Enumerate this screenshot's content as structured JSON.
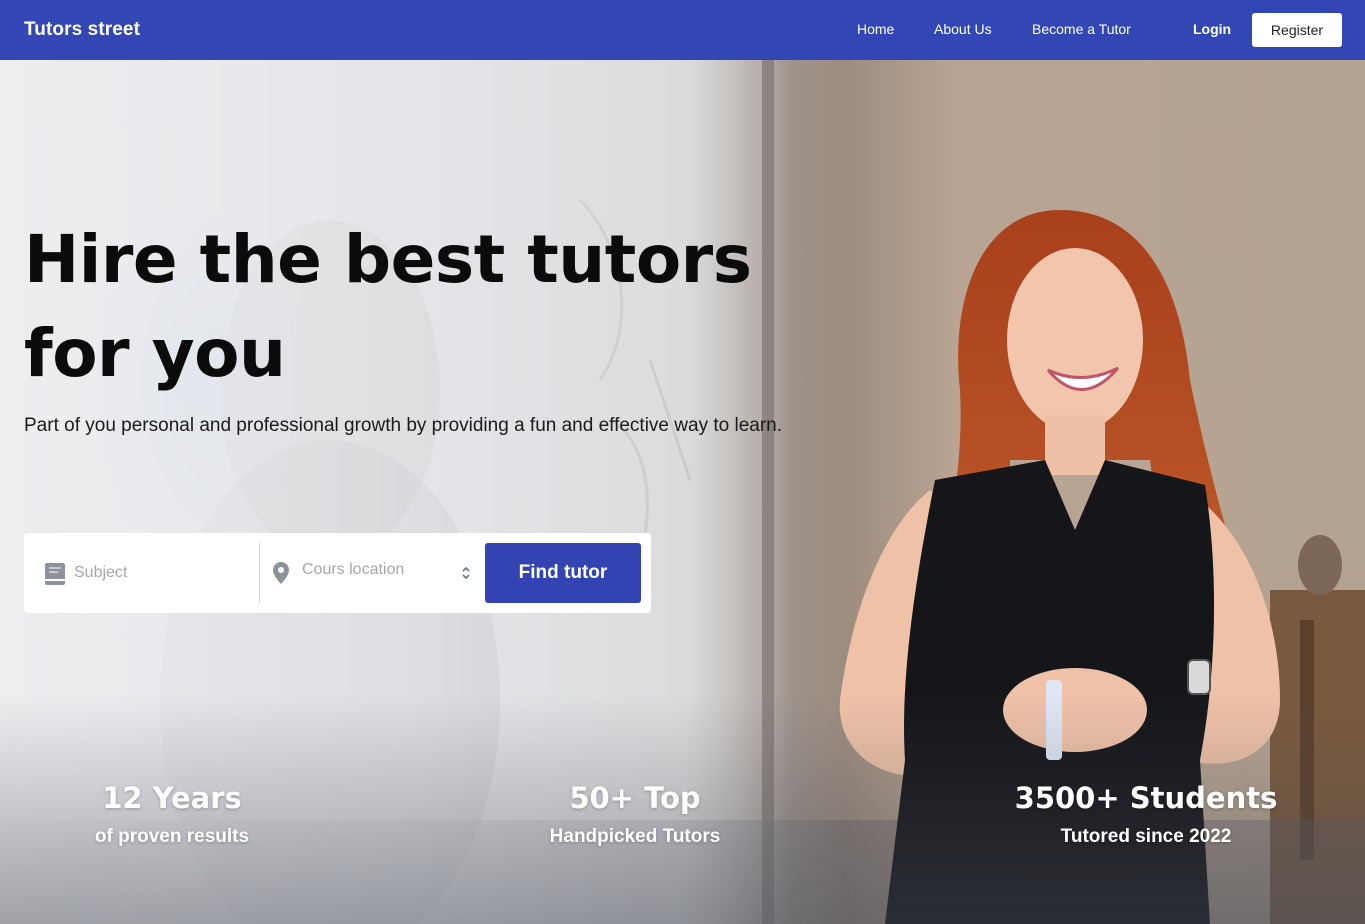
{
  "navbar": {
    "brand": "Tutors street",
    "links": [
      "Home",
      "About Us",
      "Become a Tutor"
    ],
    "login": "Login",
    "register": "Register",
    "color": "#3347b4"
  },
  "hero": {
    "headline": "Hire the best tutors for you",
    "subtitle": "Part of you personal and professional growth by providing a fun and effective way to learn."
  },
  "search": {
    "subject_placeholder": "Subject",
    "subject_icon": "book-icon",
    "location_placeholder": "Cours location",
    "location_icon": "map-pin-icon",
    "button": "Find tutor",
    "button_color": "#3344b2"
  },
  "stats": [
    {
      "value": "12 Years",
      "label": "of proven results"
    },
    {
      "value": "50+ Top",
      "label": "Handpicked Tutors"
    },
    {
      "value": "3500+ Students",
      "label": "Tutored since 2022"
    }
  ]
}
